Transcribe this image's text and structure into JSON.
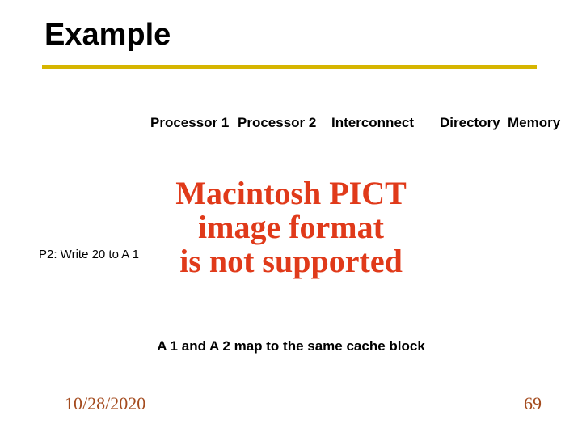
{
  "title": "Example",
  "columns": {
    "c1": "Processor 1",
    "c2": "Processor 2",
    "c3": "Interconnect",
    "c4": "Directory",
    "c5": "Memory"
  },
  "pict_error": {
    "line1": "Macintosh PICT",
    "line2": "image format",
    "line3": "is not supported"
  },
  "row_label": "P2: Write 20 to A 1",
  "caption": "A 1 and A 2 map to the same cache block",
  "footer": {
    "date": "10/28/2020",
    "page": "69"
  }
}
